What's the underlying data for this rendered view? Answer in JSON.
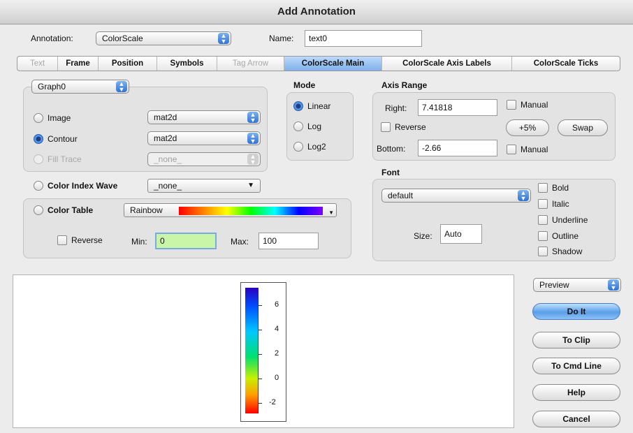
{
  "window": {
    "title": "Add Annotation"
  },
  "annotation": {
    "label": "Annotation:",
    "value": "ColorScale"
  },
  "name": {
    "label": "Name:",
    "value": "text0"
  },
  "tabs": [
    {
      "label": "Text",
      "state": "disabled"
    },
    {
      "label": "Frame",
      "state": "normal"
    },
    {
      "label": "Position",
      "state": "normal"
    },
    {
      "label": "Symbols",
      "state": "normal"
    },
    {
      "label": "Tag Arrow",
      "state": "disabled"
    },
    {
      "label": "ColorScale Main",
      "state": "selected"
    },
    {
      "label": "ColorScale Axis Labels",
      "state": "normal"
    },
    {
      "label": "ColorScale Ticks",
      "state": "normal"
    }
  ],
  "source": {
    "graph_popup": "Graph0",
    "image": {
      "label": "Image",
      "popup": "mat2d"
    },
    "contour": {
      "label": "Contour",
      "popup": "mat2d"
    },
    "fill_trace": {
      "label": "Fill Trace",
      "popup": "_none_"
    },
    "color_index_wave": {
      "label": "Color Index Wave",
      "popup": "_none_"
    },
    "color_table": {
      "label": "Color Table",
      "popup": "Rainbow"
    },
    "reverse_label": "Reverse",
    "min": {
      "label": "Min:",
      "value": "0"
    },
    "max": {
      "label": "Max:",
      "value": "100"
    }
  },
  "mode": {
    "title": "Mode",
    "options": [
      "Linear",
      "Log",
      "Log2"
    ],
    "selected": "Linear"
  },
  "axis_range": {
    "title": "Axis Range",
    "right": {
      "label": "Right:",
      "value": "7.41818"
    },
    "bottom": {
      "label": "Bottom:",
      "value": "-2.66"
    },
    "manual_label": "Manual",
    "reverse_label": "Reverse",
    "plus5_label": "+5%",
    "swap_label": "Swap"
  },
  "font": {
    "title": "Font",
    "popup": "default",
    "size_label": "Size:",
    "size_value": "Auto",
    "styles": [
      "Bold",
      "Italic",
      "Underline",
      "Outline",
      "Shadow"
    ]
  },
  "preview": {
    "tick_labels": [
      "6",
      "4",
      "2",
      "0",
      "-2"
    ]
  },
  "side": {
    "preview_popup": "Preview",
    "do_it": "Do It",
    "to_clip": "To Clip",
    "to_cmd_line": "To Cmd Line",
    "help": "Help",
    "cancel": "Cancel"
  },
  "colors": {
    "selected_tab": "#8fbdf0",
    "default_button": "#6aa8ec",
    "min_field": "#c8f5a8"
  }
}
